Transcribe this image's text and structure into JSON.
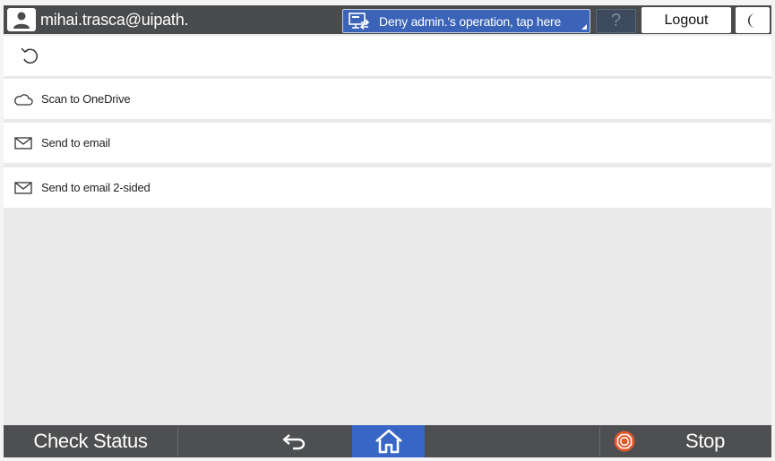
{
  "topbar": {
    "user_name": "mihai.trasca@uipath.",
    "deny_button_label": "Deny admin.'s operation, tap here",
    "help_label": "?",
    "logout_label": "Logout"
  },
  "icons": {
    "user": "user-icon",
    "remote": "monitor-remote-icon",
    "night": "moon-icon",
    "reset": "reset-icon",
    "cloud": "cloud-icon",
    "email": "envelope-icon",
    "back": "back-arrow-icon",
    "home": "home-icon",
    "stop": "stop-icon"
  },
  "list": {
    "items": [
      {
        "label": "Scan to OneDrive",
        "icon": "cloud-icon"
      },
      {
        "label": "Send to email",
        "icon": "envelope-icon"
      },
      {
        "label": "Send to email 2-sided",
        "icon": "envelope-icon"
      }
    ]
  },
  "bottombar": {
    "check_status_label": "Check Status",
    "stop_label": "Stop"
  },
  "colors": {
    "topbar_bg": "#4a4b4d",
    "deny_button_bg": "#3b63b8",
    "home_button_bg": "#3766c7",
    "stop_icon": "#e0582a",
    "content_bg": "#e9e9e9"
  }
}
